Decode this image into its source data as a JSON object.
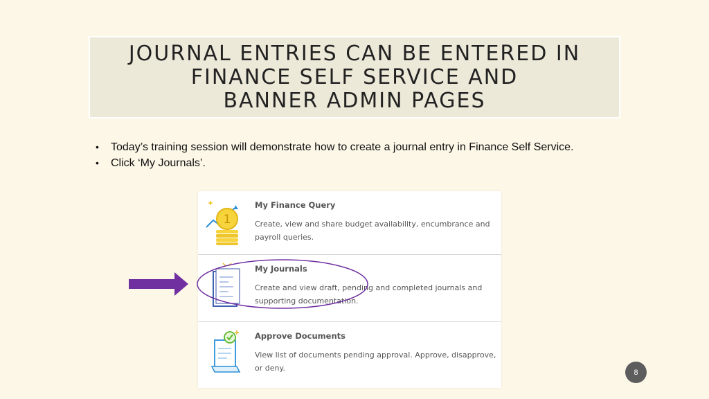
{
  "slide": {
    "title_lines": [
      "JOURNAL ENTRIES CAN BE ENTERED IN",
      "FINANCE SELF SERVICE AND",
      "BANNER ADMIN PAGES"
    ],
    "bullets": [
      "Today’s training session will demonstrate how to create a journal entry in Finance Self Service.",
      "Click ‘My Journals’."
    ],
    "page_number": "8"
  },
  "menu": {
    "items": [
      {
        "title": "My Finance Query",
        "description": "Create, view and share budget availability, encumbrance and payroll queries.",
        "icon": "coin-stack-chart-icon"
      },
      {
        "title": "My Journals",
        "description": "Create and view draft, pending and completed journals and supporting documentation.",
        "icon": "journal-document-icon"
      },
      {
        "title": "Approve Documents",
        "description": "View list of documents pending approval. Approve, disapprove, or deny.",
        "icon": "approve-document-icon"
      }
    ]
  },
  "colors": {
    "background": "#fcf7e7",
    "title_box": "#ede9d9",
    "arrow": "#7030a0",
    "highlight": "#7030a0",
    "page_badge": "#5d5d5d"
  }
}
